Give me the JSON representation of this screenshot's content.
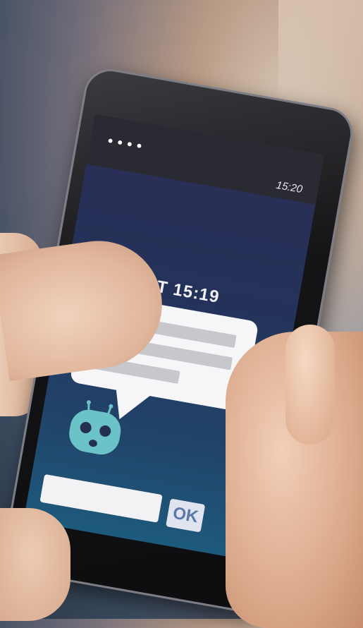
{
  "status_bar": {
    "signal_dots": "••••",
    "time": "15:20"
  },
  "chat": {
    "header": "CHATBOT 15:19"
  },
  "input": {
    "ok_label": "OK"
  },
  "colors": {
    "screen_top": "#2c2e55",
    "screen_bottom": "#1d5a7c",
    "robot": "#6cc3c7",
    "bubble": "#f6f6f8"
  },
  "icons": {
    "robot": "robot-icon"
  }
}
